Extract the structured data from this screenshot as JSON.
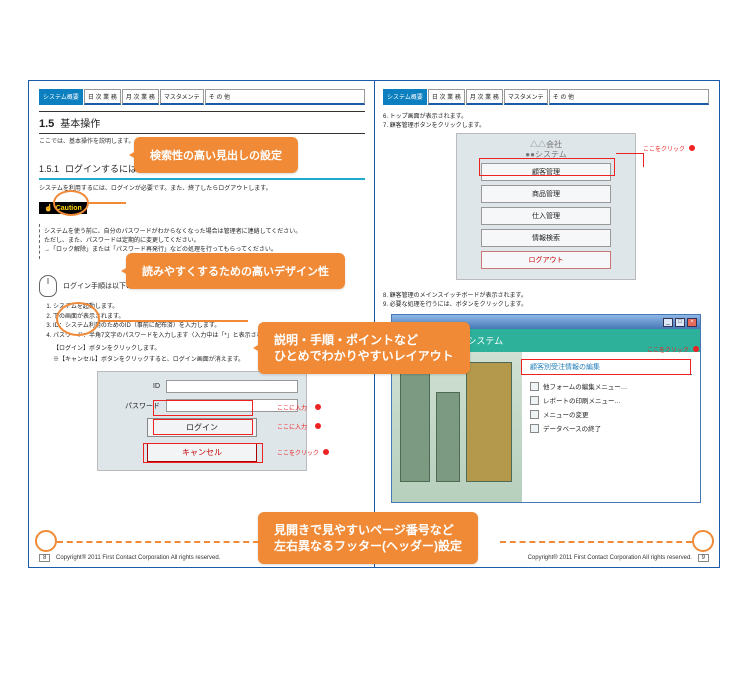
{
  "tabs": {
    "items": [
      "システム概要",
      "日 次 業 務",
      "月 次 業 務",
      "マスタメンテ",
      "そ  の  他"
    ]
  },
  "left": {
    "h1_num": "1.5",
    "h1_txt": "基本操作",
    "subline": "ここでは、基本操作を説明します。",
    "h2_num": "1.5.1",
    "h2_txt": "ログインするには",
    "lead": "システムを利用するには、ログインが必要です。また、終了したらログアウトします。",
    "caution": "Caution",
    "note1": "システムを使う前に、自分のパスワードがわからなくなった場合は管理者に連絡してください。",
    "note2": "ただし、また、パスワードは定期的に変更してください。",
    "note3": "→「ロック解除」または「パスワード再発行」などの処理を行ってもらってください。",
    "steps_title": "ログイン手順は以下の通りです。",
    "steps": [
      "システムを起動します。",
      "下の画面が表示されます。",
      "ID：システム利用のためのID（事前に配布済）を入力します。",
      "パスワード：半角7文字のパスワードを入力します（入力中は「*」と表示されます）"
    ],
    "step5": "【ログイン】ボタンをクリックします。",
    "step_note": "※【キャンセル】ボタンをクリックすると、ログイン画面が消えます。",
    "login": {
      "id_label": "ID",
      "pw_label": "パスワード",
      "login_btn": "ログイン",
      "cancel_btn": "キャンセル"
    },
    "anno_input": "ここに入力",
    "anno_click": "ここをクリック"
  },
  "right": {
    "step6": "トップ画面が表示されます。",
    "step7": "顧客管理ボタンをクリックします。",
    "sys_title_line1": "△△会社",
    "sys_title_line2": "●●システム",
    "sys_btns": [
      "顧客管理",
      "商品管理",
      "仕入管理",
      "情報検索"
    ],
    "sys_logout": "ログアウト",
    "anno_click": "ここをクリック",
    "step8": "顧客管理のメインスイッチボードが表示されます。",
    "step9": "必要な処理を行うには、ボタンをクリックします。",
    "brand": "△△株式会社  ●●システム",
    "menu_head": "顧客別受注情報の編集",
    "menu_items": [
      "他フォームの編集メニュー…",
      "レポートの印刷メニュー…",
      "メニューの変更",
      "データベースの終了"
    ]
  },
  "callouts": {
    "c1": "検索性の高い見出しの設定",
    "c2": "読みやすくするための高いデザイン性",
    "c3a": "説明・手順・ポイントなど",
    "c3b": "ひとめでわかりやすいレイアウト",
    "c4a": "見開きで見やすいページ番号など",
    "c4b": "左右異なるフッター(ヘッダー)設定"
  },
  "footer": {
    "left_num": "8",
    "right_num": "9",
    "text": "Copyright® 2011 First Contact Corporation    All rights reserved."
  }
}
